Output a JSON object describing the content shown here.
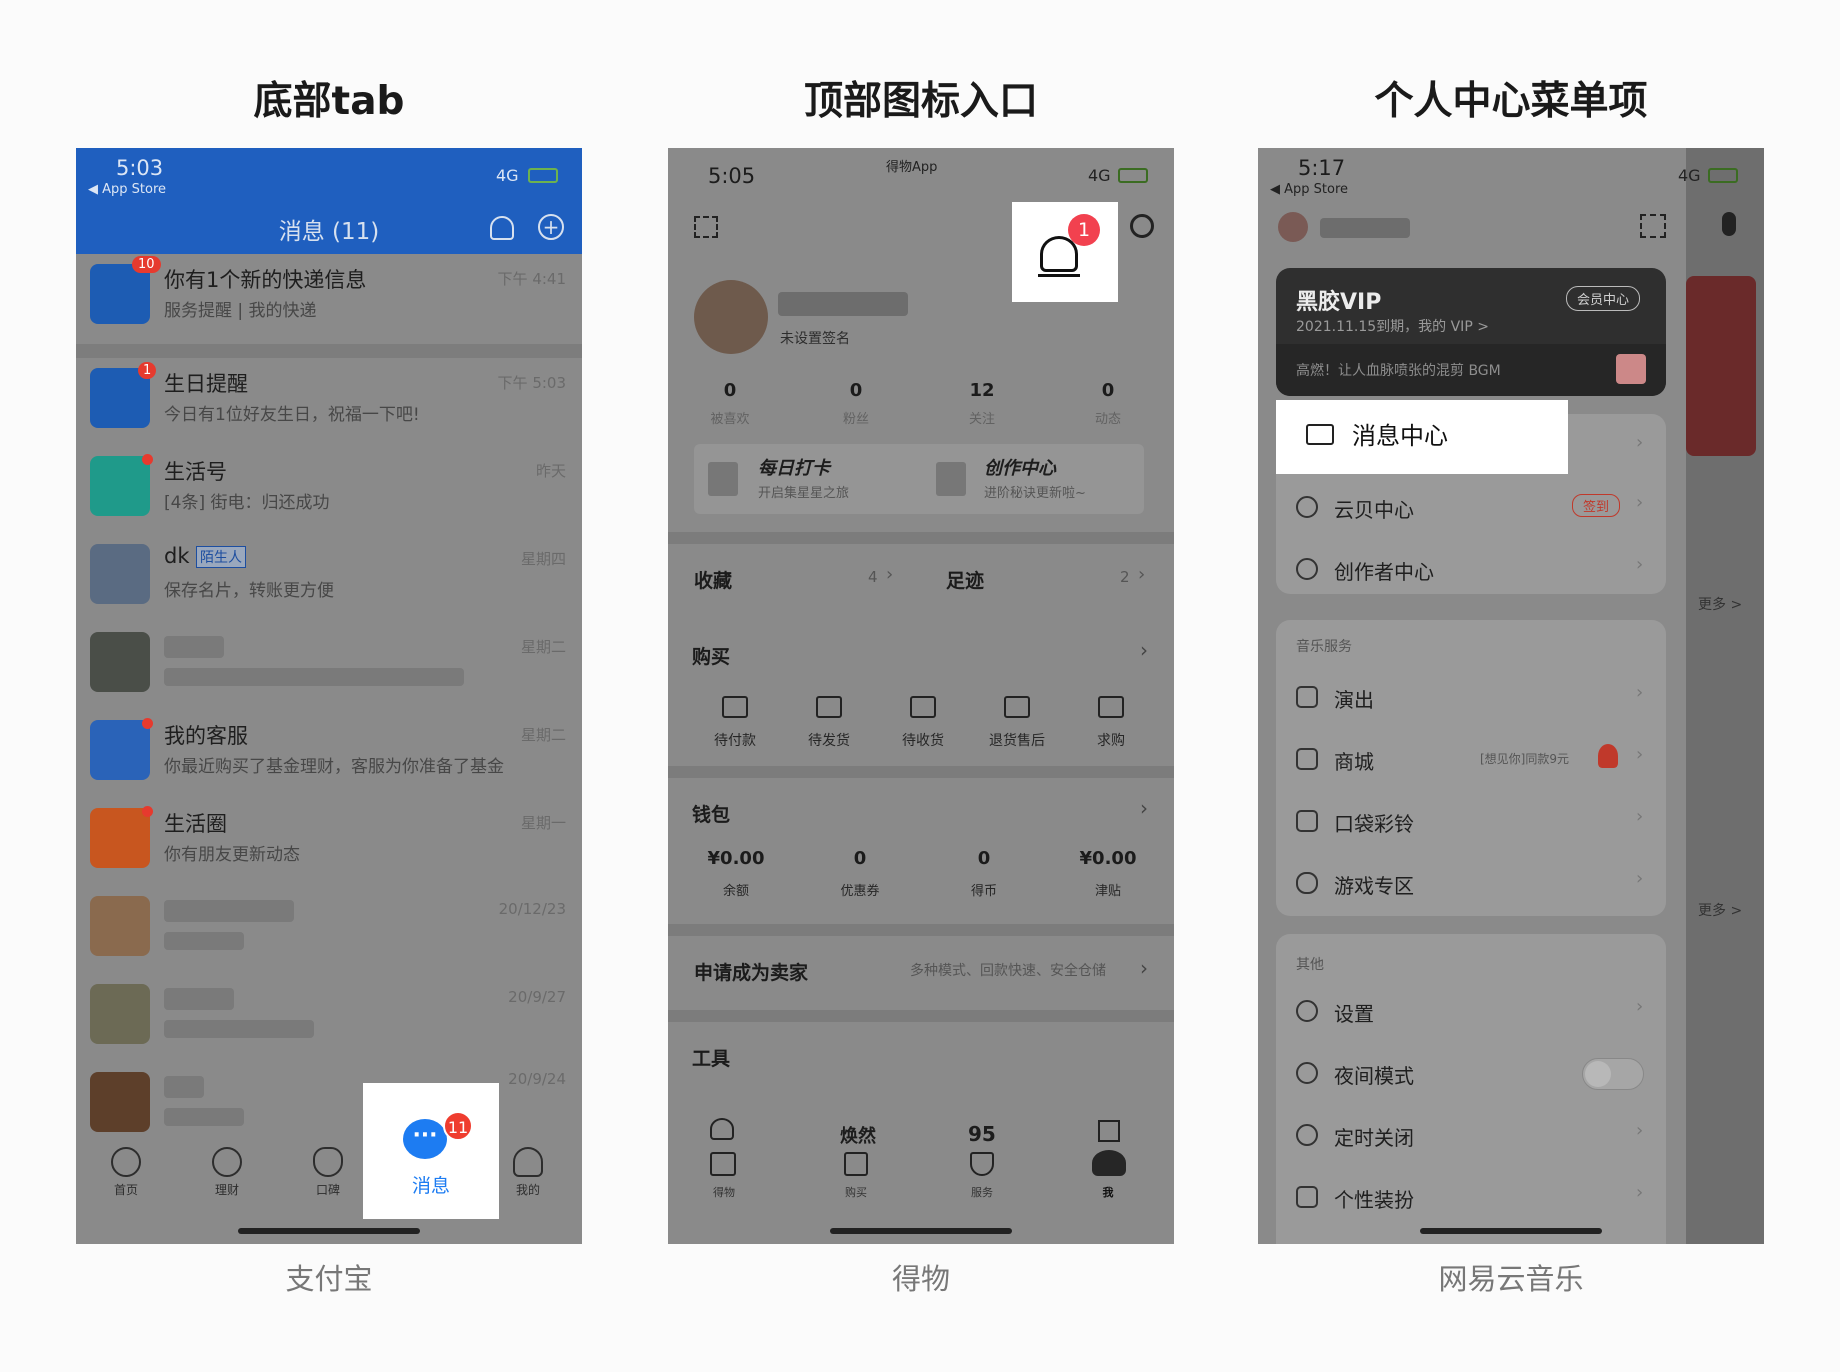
{
  "columns": [
    {
      "title": "底部tab",
      "caption": "支付宝"
    },
    {
      "title": "顶部图标入口",
      "caption": "得物"
    },
    {
      "title": "个人中心菜单项",
      "caption": "网易云音乐"
    }
  ],
  "alipay": {
    "status_time": "5:03",
    "back_app": "◀ App Store",
    "network": "4G",
    "nav_title": "消息 (11)",
    "rows": [
      {
        "name": "你有1个新的快递信息",
        "sub": "服务提醒 | 我的快递",
        "time": "下午 4:41",
        "badge": "10"
      },
      {
        "name": "生日提醒",
        "sub": "今日有1位好友生日，祝福一下吧!",
        "time": "下午 5:03",
        "badge": "1"
      },
      {
        "name": "生活号",
        "sub": "[4条] 街电：归还成功",
        "time": "昨天"
      },
      {
        "name": "dk",
        "tag": "陌生人",
        "sub": "保存名片，转账更方便",
        "time": "星期四"
      },
      {
        "time": "星期二"
      },
      {
        "name": "我的客服",
        "sub": "你最近购买了基金理财，客服为你准备了基金",
        "time": "星期二"
      },
      {
        "name": "生活圈",
        "sub": "你有朋友更新动态",
        "time": "星期一"
      },
      {
        "time": "20/12/23"
      },
      {
        "time": "20/9/27"
      },
      {
        "time": "20/9/24"
      }
    ],
    "tabs": [
      "首页",
      "理财",
      "口碑",
      "消息",
      "我的"
    ],
    "tab_badge": "11"
  },
  "dewu": {
    "status_time": "5:05",
    "app_label": "得物App",
    "network": "4G",
    "bell_badge": "1",
    "profile_sign": "未设置签名",
    "stats": [
      {
        "v": "0",
        "l": "被喜欢"
      },
      {
        "v": "0",
        "l": "粉丝"
      },
      {
        "v": "12",
        "l": "关注"
      },
      {
        "v": "0",
        "l": "动态"
      }
    ],
    "card1_title": "每日打卡",
    "card1_sub": "开启集星星之旅",
    "card2_title": "创作中心",
    "card2_sub": "进阶秘诀更新啦~",
    "fav": "收藏",
    "fav_count": "4",
    "track": "足迹",
    "track_count": "2",
    "buy": "购买",
    "buy_items": [
      "待付款",
      "待发货",
      "待收货",
      "退货售后",
      "求购"
    ],
    "wallet": "钱包",
    "wallet_items": [
      {
        "v": "¥0.00",
        "l": "余额"
      },
      {
        "v": "0",
        "l": "优惠券"
      },
      {
        "v": "0",
        "l": "得币"
      },
      {
        "v": "¥0.00",
        "l": "津贴"
      }
    ],
    "seller": "申请成为卖家",
    "seller_sub": "多种模式、回款快速、安全仓储",
    "tools": "工具",
    "tool_marks": [
      "焕然",
      "95"
    ],
    "tabs": [
      "得物",
      "购买",
      "服务",
      "我"
    ]
  },
  "netease": {
    "status_time": "5:17",
    "back_app": "◀ App Store",
    "network": "4G",
    "vip_logo": "黑胶VIP",
    "vip_btn": "会员中心",
    "vip_date": "2021.11.15到期，我的 VIP >",
    "vip_slogan": "高燃！让人血脉喷张的混剪 BGM",
    "menu1": [
      {
        "label": "消息中心"
      },
      {
        "label": "云贝中心",
        "extra": "签到"
      },
      {
        "label": "创作者中心"
      }
    ],
    "music_section": "音乐服务",
    "menu2": [
      {
        "label": "演出"
      },
      {
        "label": "商城",
        "extra": "[想见你]同款9元"
      },
      {
        "label": "口袋彩铃"
      },
      {
        "label": "游戏专区"
      }
    ],
    "other_section": "其他",
    "menu3": [
      {
        "label": "设置"
      },
      {
        "label": "夜间模式"
      },
      {
        "label": "定时关闭"
      },
      {
        "label": "个性装扮"
      }
    ],
    "side_more": "更多 >"
  }
}
